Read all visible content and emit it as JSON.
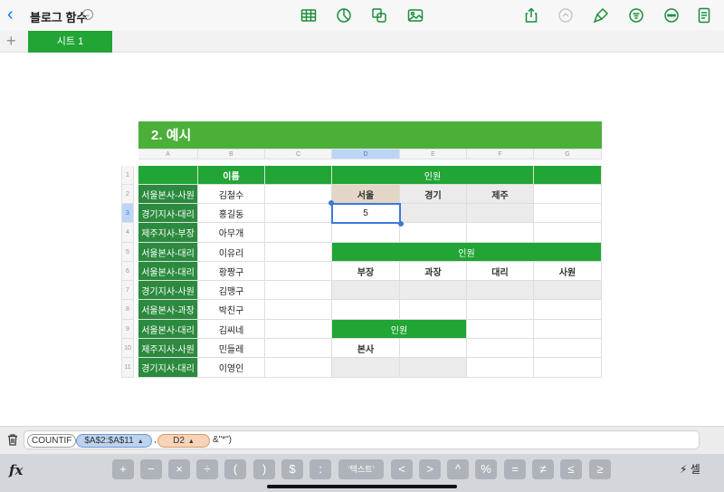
{
  "header": {
    "doc_title": "블로그 함수",
    "icons": [
      "table-icon",
      "chart-icon",
      "shape-icon",
      "media-icon",
      "share-icon",
      "undo-icon",
      "format-brush-icon",
      "organize-icon",
      "more-icon",
      "document-icon"
    ]
  },
  "tabs": {
    "add_label": "+",
    "sheets": [
      "시트 1"
    ]
  },
  "table": {
    "title": "2.  예시",
    "columns": [
      "A",
      "B",
      "C",
      "D",
      "E",
      "F",
      "G"
    ],
    "rows": [
      "1",
      "2",
      "3",
      "4",
      "5",
      "6",
      "7",
      "8",
      "9",
      "10",
      "11"
    ],
    "col_a": [
      "서울본사-사원",
      "경기지사-대리",
      "제주지사-부장",
      "서울본사-대리",
      "서울본사-대리",
      "경기지사-사원",
      "서울본사-과장",
      "서울본사-대리",
      "제주지사-사원",
      "경기지사-대리"
    ],
    "name_header": "이름",
    "names": [
      "김철수",
      "홍길동",
      "아무개",
      "이유리",
      "황짱구",
      "김맹구",
      "박친구",
      "김씨네",
      "민들레",
      "이영인"
    ],
    "block1": {
      "header": "인원",
      "labels": [
        "서울",
        "경기",
        "제주"
      ],
      "value": "5"
    },
    "block2": {
      "header": "인원",
      "labels": [
        "부장",
        "과장",
        "대리",
        "사원"
      ]
    },
    "block3": {
      "header": "인원",
      "label": "본사"
    }
  },
  "formula": {
    "function": "COUNTIF",
    "range_token": "$A$2:$A$11",
    "separator": ",",
    "cell_token": "D2",
    "suffix": "&\"*\")"
  },
  "keyboard": {
    "fx_label": "fx",
    "keys": [
      "+",
      "−",
      "×",
      "÷",
      "(",
      ")",
      "$",
      ":",
      "‘텍스트’",
      "<",
      ">",
      "^",
      "%",
      "=",
      "≠",
      "≤",
      "≥"
    ],
    "cell_mode_label": "⚡ 셀"
  },
  "colors": {
    "accent": "#21a535",
    "label_green": "#2c8a3e",
    "selection": "#3d78d8"
  }
}
